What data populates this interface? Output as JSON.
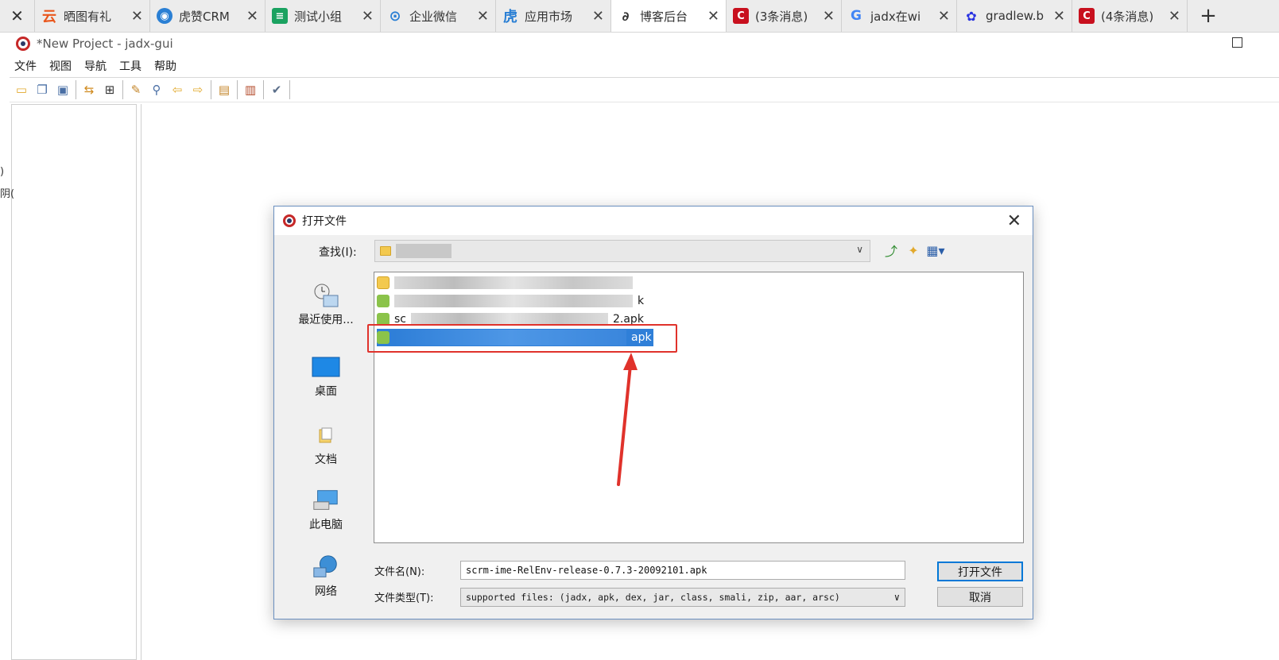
{
  "browser_tabs": [
    {
      "title": "晒图有礼",
      "icon": "yun-icon",
      "color": "#e9561c"
    },
    {
      "title": "虎赞CRM",
      "icon": "globe-icon",
      "color": "#2a7fd4"
    },
    {
      "title": "测试小组",
      "icon": "sheet-icon",
      "color": "#1aa260"
    },
    {
      "title": "企业微信",
      "icon": "wecom-icon",
      "color": "#2a7fd4"
    },
    {
      "title": "应用市场",
      "icon": "tiger-icon",
      "color": "#2a7fd4"
    },
    {
      "title": "博客后台",
      "icon": "blog-icon",
      "color": "#333333",
      "active": true
    },
    {
      "title": "(3条消息)",
      "icon": "csdn-icon",
      "color": "#c8101e"
    },
    {
      "title": "jadx在wi",
      "icon": "google-icon",
      "color": "#4285f4"
    },
    {
      "title": "gradlew.b",
      "icon": "baidu-icon",
      "color": "#2932e1"
    },
    {
      "title": "(4条消息)",
      "icon": "csdn-icon",
      "color": "#c8101e"
    }
  ],
  "window": {
    "title": "*New Project - jadx-gui",
    "menu": [
      "文件",
      "视图",
      "导航",
      "工具",
      "帮助"
    ],
    "toolbar_icons": [
      "open-folder-icon",
      "save-all-icon",
      "save-project-icon",
      "sync-icon",
      "tree-icon",
      "jump-icon",
      "search-icon",
      "back-icon",
      "forward-icon",
      "decompile-icon",
      "log-icon",
      "settings-icon"
    ],
    "edge_text": [
      ")",
      "阴("
    ]
  },
  "dialog": {
    "title": "打开文件",
    "lookin_label": "查找(I):",
    "lookin_value": "",
    "places": [
      "最近使用...",
      "桌面",
      "文档",
      "此电脑",
      "网络"
    ],
    "files": [
      {
        "name_suffix": "",
        "type": "folder"
      },
      {
        "name_suffix": "k",
        "type": "apk"
      },
      {
        "name_prefix": "sc",
        "name_suffix": "2.apk",
        "type": "apk"
      },
      {
        "name_suffix": "apk",
        "type": "apk",
        "selected": true
      }
    ],
    "filename_label": "文件名(N):",
    "filename_value": "scrm-ime-RelEnv-release-0.7.3-20092101.apk",
    "filetype_label": "文件类型(T):",
    "filetype_value": "supported files: (jadx, apk, dex, jar, class, smali, zip, aar, arsc)",
    "open_button": "打开文件",
    "cancel_button": "取消"
  }
}
